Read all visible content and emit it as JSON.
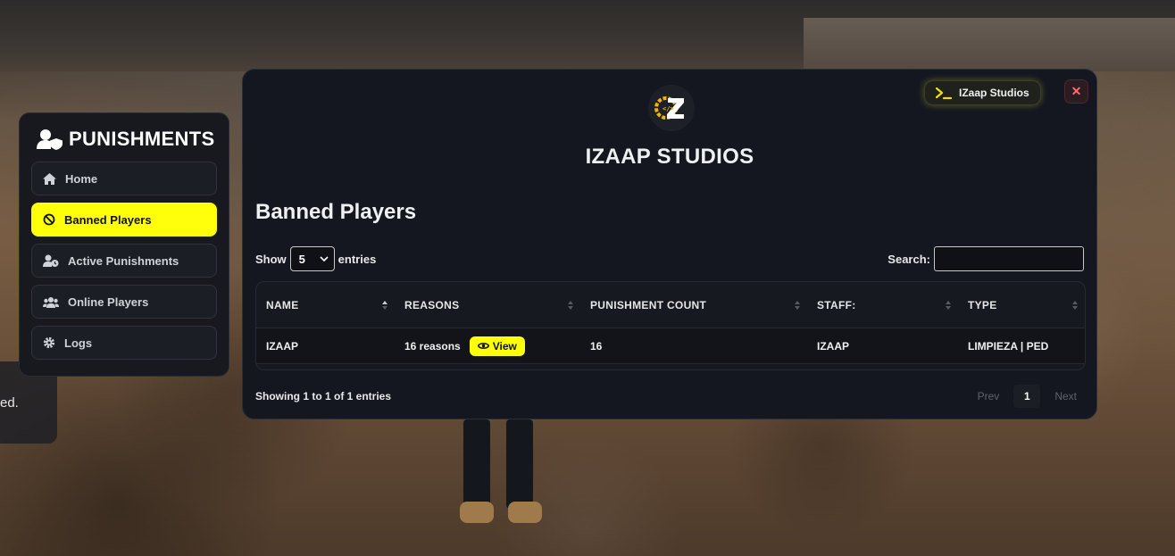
{
  "sidebar": {
    "title": "PUNISHMENTS",
    "items": [
      {
        "label": "Home",
        "icon": "home-icon",
        "active": false
      },
      {
        "label": "Banned Players",
        "icon": "ban-icon",
        "active": true
      },
      {
        "label": "Active Punishments",
        "icon": "user-clock-icon",
        "active": false
      },
      {
        "label": "Online Players",
        "icon": "users-icon",
        "active": false
      },
      {
        "label": "Logs",
        "icon": "gear-icon",
        "active": false
      }
    ]
  },
  "background": {
    "side_text": "ed."
  },
  "modal": {
    "brand": "IZAAP STUDIOS",
    "studio_button": "IZaap Studios",
    "close": "✕",
    "section_title": "Banned Players",
    "length": {
      "prefix": "Show",
      "value": "5",
      "suffix": "entries"
    },
    "search": {
      "label": "Search:",
      "value": ""
    },
    "table": {
      "columns": [
        "NAME",
        "REASONS",
        "PUNISHMENT COUNT",
        "STAFF:",
        "TYPE"
      ],
      "sorted_column": "NAME",
      "rows": [
        {
          "name": "IZAAP",
          "reasons": "16 reasons",
          "view_label": "View",
          "count": "16",
          "staff": "IZAAP",
          "type": "LIMPIEZA | PED"
        }
      ]
    },
    "info": "Showing 1 to 1 of 1 entries",
    "pagination": {
      "prev": "Prev",
      "current": "1",
      "next": "Next"
    }
  },
  "colors": {
    "accent": "#ffff0a",
    "panel": "#141720",
    "sidebar": "#17191f",
    "close": "#ff6b6b"
  }
}
